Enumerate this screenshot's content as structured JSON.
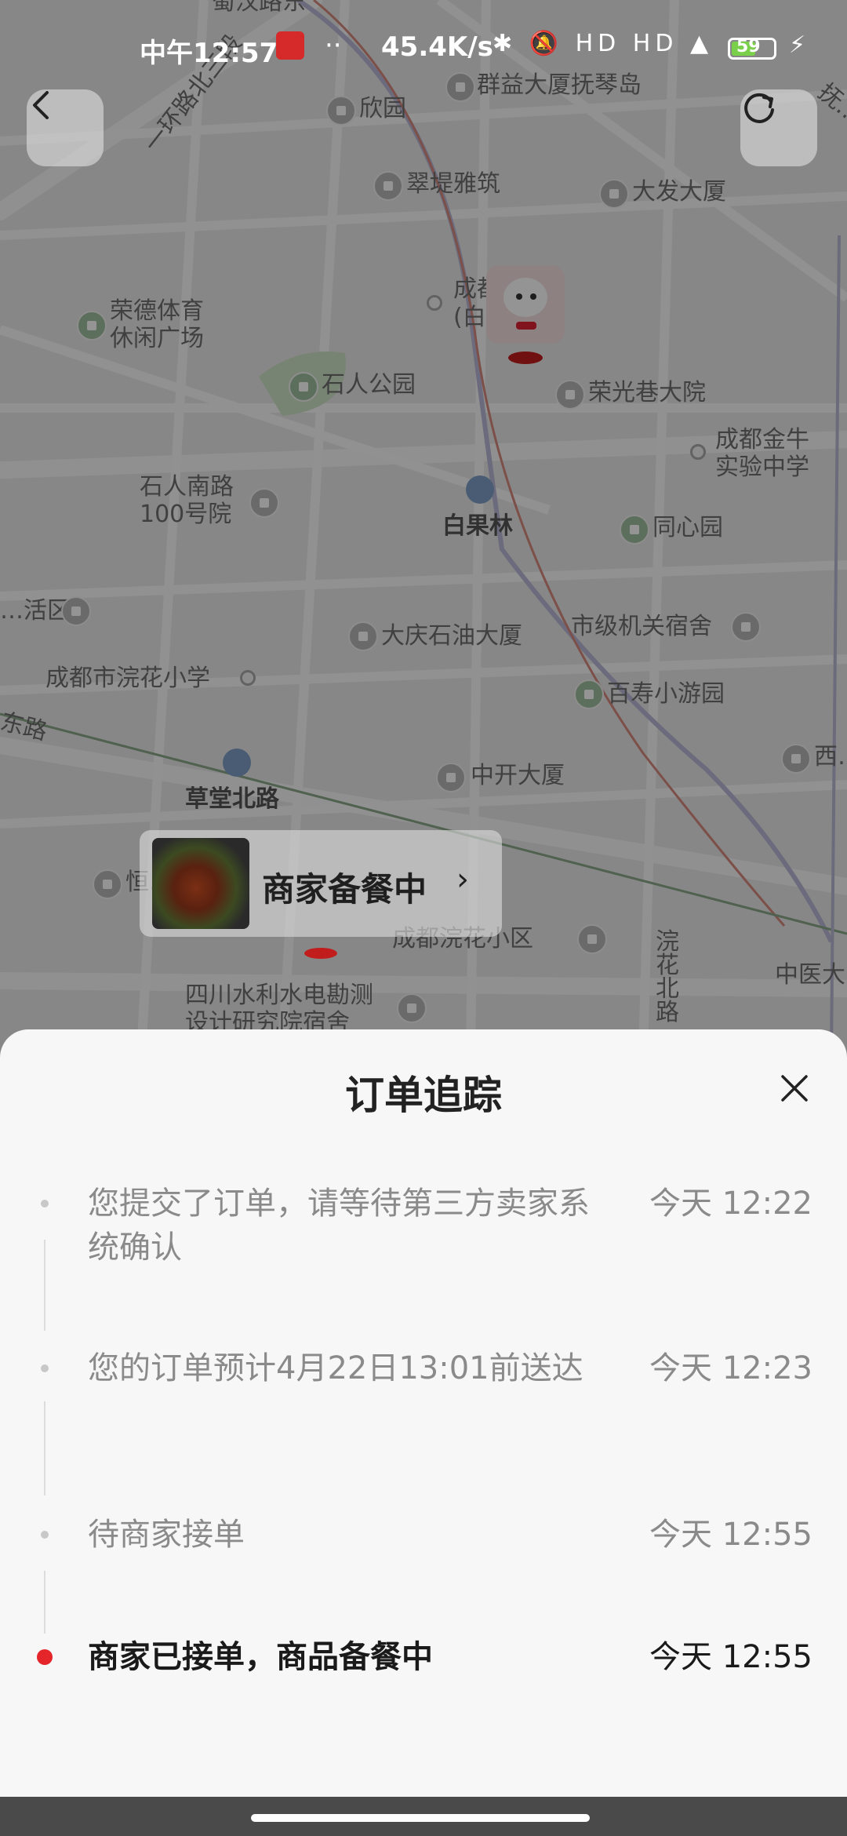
{
  "status_bar": {
    "time": "中午12:57",
    "dots": "··",
    "net_speed": "45.4K/s",
    "icons": "✱ 🔕 HD HD ▲",
    "battery": "59",
    "charging": "⚡"
  },
  "map": {
    "labels": {
      "top_road": "蜀汉路东",
      "ring_road": "一环路北三段",
      "qunyi": "群益大厦抚琴岛",
      "xinyuan": "欣园",
      "cuiti": "翠堤雅筑",
      "dafa": "大发大厦",
      "chengdu_zhong": "成都…中",
      "chengdu_zhong2": "(白…区)",
      "rongde": "荣德体育\n休闲广场",
      "shiren_park": "石人公园",
      "rongguang": "荣光巷大院",
      "jinniu": "成都金牛\n实验中学",
      "shiren_nanlu": "石人南路\n100号院",
      "baiguolin": "白果林",
      "tongxin": "同心园",
      "huo": "…活区",
      "daqing": "大庆石油大厦",
      "shiji": "市级机关宿舍",
      "huanhua_school": "成都市浣花小学",
      "baishou": "百寿小游园",
      "dong_road": "东路",
      "caotang": "草堂北路",
      "zhongkai": "中开大厦",
      "xi": "西…",
      "huanhua_xiaoqu": "成都浣花小区",
      "huanhua_beilu": "浣花北路",
      "zhongyi": "中医大",
      "shuili": "四川水利水电勘测\n设计研究院宿舍",
      "heng": "恒…",
      "fuqin": "抚…"
    }
  },
  "shop_card": {
    "label": "商家备餐中",
    "chevron": "›"
  },
  "sheet": {
    "title": "订单追踪",
    "events": [
      {
        "text": "您提交了订单，请等待第三方卖家系统确认",
        "time": "今天 12:22",
        "active": false
      },
      {
        "text": "您的订单预计4月22日13:01前送达",
        "time": "今天 12:23",
        "active": false
      },
      {
        "text": "待商家接单",
        "time": "今天 12:55",
        "active": false
      },
      {
        "text": "商家已接单，商品备餐中",
        "time": "今天 12:55",
        "active": true
      }
    ]
  },
  "colors": {
    "accent_red": "#e4262b",
    "sheet_bg": "#f7f7f7"
  }
}
